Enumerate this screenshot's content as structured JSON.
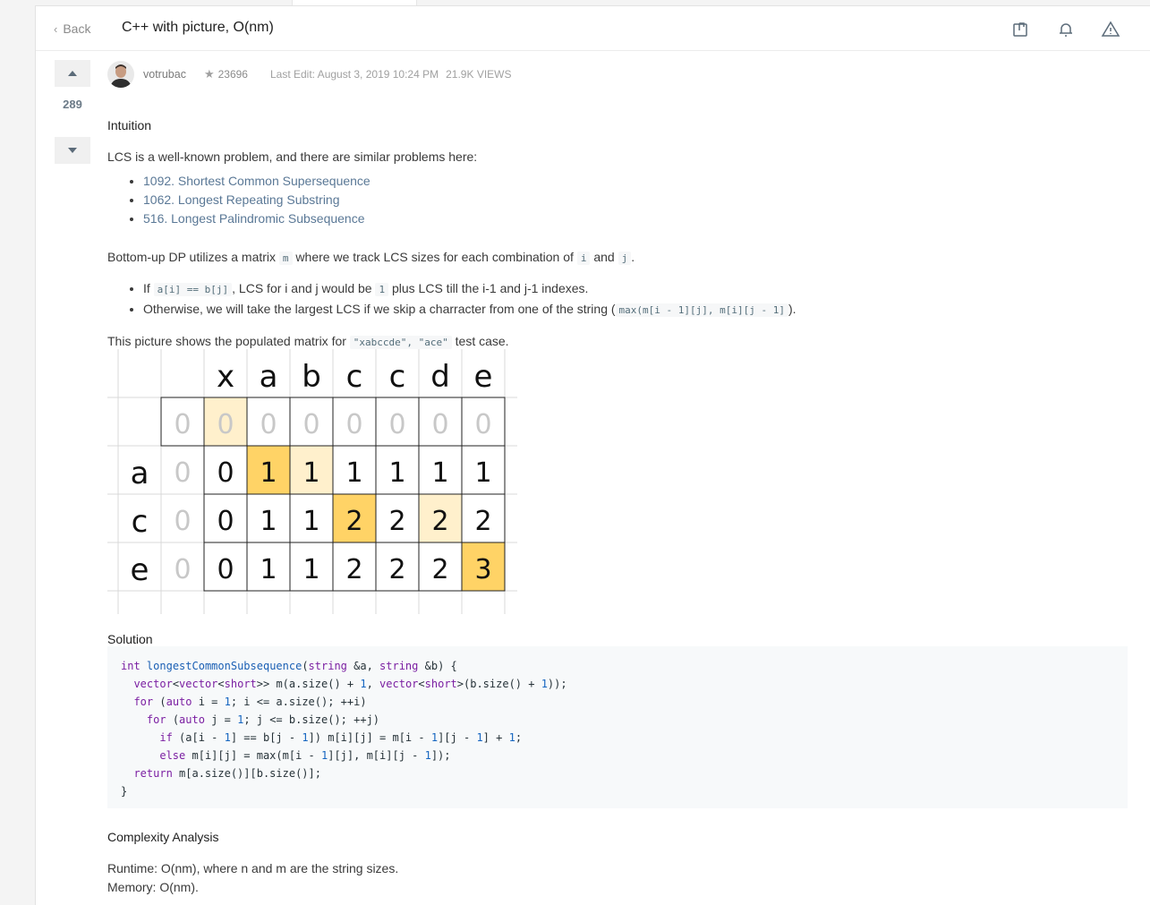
{
  "header": {
    "back_label": "Back",
    "title": "C++ with picture, O(nm)"
  },
  "vote": {
    "count": "289"
  },
  "meta": {
    "author": "votrubac",
    "reputation": "23696",
    "last_edit": "Last Edit: August 3, 2019 10:24 PM",
    "views": "21.9K VIEWS"
  },
  "post": {
    "intuition_heading": "Intuition",
    "intro": "LCS is a well-known problem, and there are similar problems here:",
    "links": [
      "1092. Shortest Common Supersequence",
      "1062. Longest Repeating Substring",
      "516. Longest Palindromic Subsequence"
    ],
    "dp_text_a": "Bottom-up DP utilizes a matrix ",
    "dp_code_m": "m",
    "dp_text_b": " where we track LCS sizes for each combination of ",
    "dp_code_i": "i",
    "dp_text_c": " and ",
    "dp_code_j": "j",
    "dp_text_d": ".",
    "bullet1_a": "If ",
    "bullet1_code": "a[i] == b[j]",
    "bullet1_b": ", LCS for i and j would be ",
    "bullet1_code2": "1",
    "bullet1_c": " plus LCS till the i-1 and j-1 indexes.",
    "bullet2_a": "Otherwise, we will take the largest LCS if we skip a charracter from one of the string (",
    "bullet2_code": "max(m[i - 1][j], m[i][j - 1]",
    "bullet2_b": ").",
    "picture_a": "This picture shows the populated matrix for ",
    "picture_code": "\"xabccde\", \"ace\"",
    "picture_b": " test case.",
    "solution_heading": "Solution",
    "complexity_heading": "Complexity Analysis",
    "runtime": "Runtime: O(nm), where n and m are the string sizes.",
    "memory": "Memory: O(nm)."
  },
  "matrix": {
    "cols": [
      "x",
      "a",
      "b",
      "c",
      "c",
      "d",
      "e"
    ],
    "rows": [
      "a",
      "c",
      "e"
    ],
    "values": [
      [
        0,
        0,
        0,
        0,
        0,
        0,
        0,
        0,
        0
      ],
      [
        0,
        0,
        1,
        1,
        1,
        1,
        1,
        1
      ],
      [
        0,
        0,
        1,
        1,
        2,
        2,
        2,
        2
      ],
      [
        0,
        0,
        1,
        1,
        2,
        2,
        2,
        3
      ]
    ],
    "colors": {
      "strong": "#ffd366",
      "light": "#fff0cc",
      "faded": "#c8c8c8",
      "border": "#222222",
      "grid": "#d9d9d9"
    }
  },
  "code": [
    "int longestCommonSubsequence(string &a, string &b) {",
    "  vector<vector<short>> m(a.size() + 1, vector<short>(b.size() + 1));",
    "  for (auto i = 1; i <= a.size(); ++i)",
    "    for (auto j = 1; j <= b.size(); ++j)",
    "      if (a[i - 1] == b[j - 1]) m[i][j] = m[i - 1][j - 1] + 1;",
    "      else m[i][j] = max(m[i - 1][j], m[i][j - 1]);",
    "  return m[a.size()][b.size()];",
    "}"
  ],
  "icons": [
    "share-icon",
    "bell-icon",
    "warning-icon",
    "upvote-icon",
    "downvote-icon",
    "star-icon"
  ]
}
